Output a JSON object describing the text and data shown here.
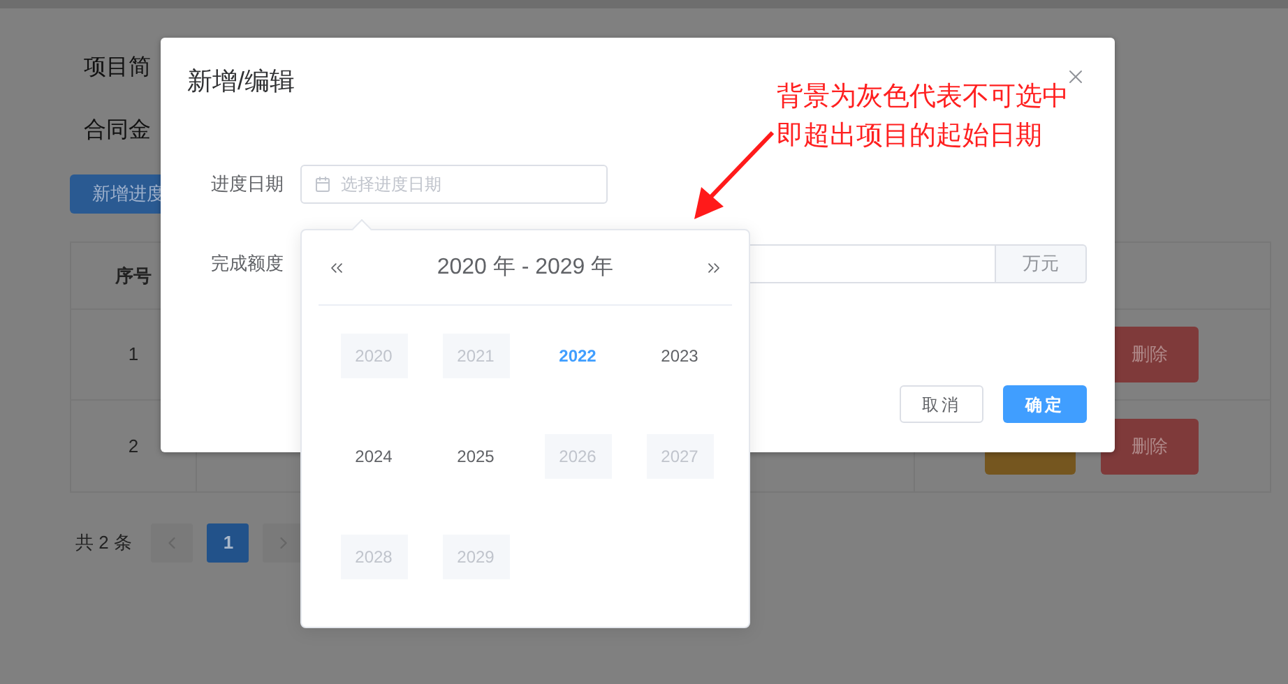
{
  "background_page": {
    "fields": [
      {
        "label": "项目简"
      },
      {
        "label": "合同金"
      }
    ],
    "add_button": "新增进度",
    "table": {
      "columns": [
        "序号"
      ],
      "rows": [
        {
          "index": "1",
          "delete": "删除"
        },
        {
          "index": "2",
          "delete": "删除"
        }
      ]
    },
    "pagination": {
      "total": "共 2 条",
      "pages": [
        {
          "label": "1",
          "selected": true
        }
      ]
    }
  },
  "dialog": {
    "title": "新增/编辑",
    "fields": [
      {
        "label": "进度日期",
        "kind": "date",
        "placeholder": "选择进度日期"
      },
      {
        "label": "完成额度",
        "kind": "amount",
        "suffix": "万元"
      }
    ],
    "buttons": [
      {
        "label": "取消",
        "kind": "default"
      },
      {
        "label": "确定",
        "kind": "primary"
      }
    ]
  },
  "year_picker": {
    "title": "2020 年 - 2029 年",
    "years": [
      {
        "label": "2020",
        "disabled": true,
        "selected": false
      },
      {
        "label": "2021",
        "disabled": true,
        "selected": false
      },
      {
        "label": "2022",
        "disabled": false,
        "selected": true
      },
      {
        "label": "2023",
        "disabled": false,
        "selected": false
      },
      {
        "label": "2024",
        "disabled": false,
        "selected": false
      },
      {
        "label": "2025",
        "disabled": false,
        "selected": false
      },
      {
        "label": "2026",
        "disabled": true,
        "selected": false
      },
      {
        "label": "2027",
        "disabled": true,
        "selected": false
      },
      {
        "label": "2028",
        "disabled": true,
        "selected": false
      },
      {
        "label": "2029",
        "disabled": true,
        "selected": false
      }
    ]
  },
  "annotation": {
    "lines": [
      "背景为灰色代表不可选中",
      "即超出项目的起始日期"
    ]
  }
}
